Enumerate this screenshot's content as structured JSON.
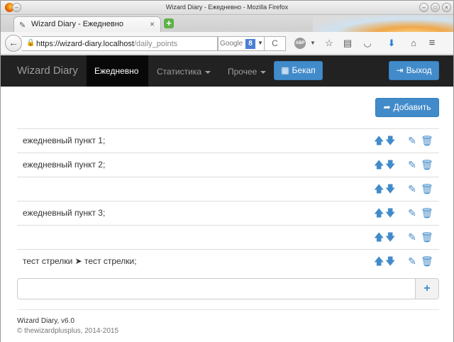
{
  "window": {
    "title": "Wizard Diary - Ежедневно - Mozilla Firefox",
    "controls": [
      "minimize",
      "maximize",
      "close"
    ]
  },
  "tab": {
    "title": "Wizard Diary - Ежедневно",
    "close": "×",
    "new_tab": "+"
  },
  "toolbar": {
    "back": "←",
    "url_host": "https://wizard-diary.localhost",
    "url_path": "/daily_points",
    "search_placeholder": "Google",
    "search_engine_letter": "8",
    "reload": "C",
    "adblock": "ABP"
  },
  "site": {
    "brand": "Wizard Diary",
    "nav": {
      "active": "Ежедневно",
      "stats": "Статистика",
      "other": "Прочее"
    },
    "backup_label": "Бекап",
    "logout_label": "Выход",
    "add_label": "Добавить"
  },
  "points": [
    {
      "text": "ежедневный пункт 1;"
    },
    {
      "text": "ежедневный пункт 2;"
    },
    {
      "text": ""
    },
    {
      "text": "ежедневный пункт 3;"
    },
    {
      "text": ""
    },
    {
      "text": "тест стрелки ➤ тест стрелки;"
    }
  ],
  "new_point": {
    "value": "",
    "button": "+"
  },
  "footer": {
    "version": "Wizard Diary, v6.0",
    "copyright": "© thewizardplusplus, 2014-2015"
  },
  "colors": {
    "navbar": "#222222",
    "primary": "#428bca",
    "accent_icons": "#428bca"
  }
}
